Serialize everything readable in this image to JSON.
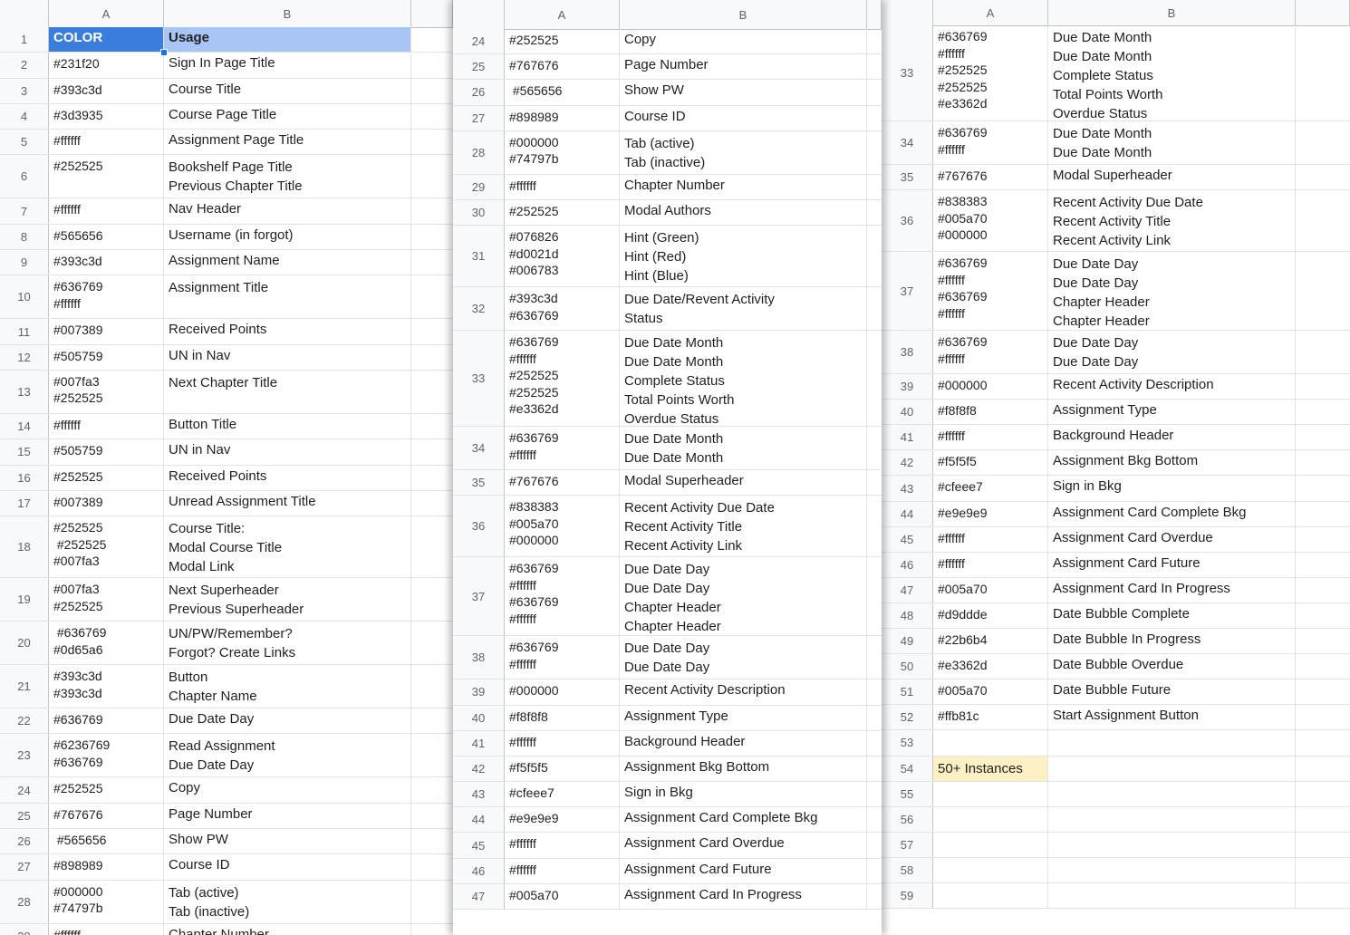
{
  "panels": [
    {
      "id": "p1",
      "column_headers": [
        "A",
        "B"
      ],
      "rows": [
        {
          "n": "1",
          "a": "COLOR",
          "b": "Usage"
        },
        {
          "n": "2",
          "a": "#231f20",
          "b": "Sign In Page Title"
        },
        {
          "n": "3",
          "a": "#393c3d",
          "b": "Course Title"
        },
        {
          "n": "4",
          "a": "#3d3935",
          "b": "Course Page Title"
        },
        {
          "n": "5",
          "a": "#ffffff",
          "b": "Assignment Page Title"
        },
        {
          "n": "6",
          "a": "#252525",
          "b": "Bookshelf Page Title\nPrevious Chapter Title"
        },
        {
          "n": "7",
          "a": "#ffffff",
          "b": "Nav Header"
        },
        {
          "n": "8",
          "a": "#565656",
          "b": "Username (in forgot)"
        },
        {
          "n": "9",
          "a": "#393c3d",
          "b": "Assignment Name"
        },
        {
          "n": "10",
          "a": "#636769\n#ffffff",
          "b": "Assignment Title"
        },
        {
          "n": "11",
          "a": "#007389",
          "b": "Received Points"
        },
        {
          "n": "12",
          "a": "#505759",
          "b": "UN in Nav"
        },
        {
          "n": "13",
          "a": "#007fa3\n#252525",
          "b": "Next Chapter Title"
        },
        {
          "n": "14",
          "a": "#ffffff",
          "b": "Button Title"
        },
        {
          "n": "15",
          "a": "#505759",
          "b": "UN in Nav"
        },
        {
          "n": "16",
          "a": "#252525",
          "b": "Received Points"
        },
        {
          "n": "17",
          "a": "#007389",
          "b": "Unread Assignment Title"
        },
        {
          "n": "18",
          "a": "#252525\n #252525\n#007fa3",
          "b": "Course Title:\nModal Course Title\nModal Link"
        },
        {
          "n": "19",
          "a": "#007fa3\n#252525",
          "b": "Next Superheader\nPrevious Superheader"
        },
        {
          "n": "20",
          "a": " #636769\n#0d65a6",
          "b": "UN/PW/Remember?\nForgot? Create Links"
        },
        {
          "n": "21",
          "a": "#393c3d\n#393c3d",
          "b": "Button\nChapter Name"
        },
        {
          "n": "22",
          "a": "#636769",
          "b": "Due Date Day"
        },
        {
          "n": "23",
          "a": "#6236769\n#636769",
          "b": "Read Assignment\nDue Date Day"
        },
        {
          "n": "24",
          "a": "#252525",
          "b": "Copy"
        },
        {
          "n": "25",
          "a": "#767676",
          "b": "Page Number"
        },
        {
          "n": "26",
          "a": " #565656",
          "b": "Show PW"
        },
        {
          "n": "27",
          "a": "#898989",
          "b": "Course ID"
        },
        {
          "n": "28",
          "a": "#000000\n#74797b",
          "b": "Tab (active)\nTab (inactive)"
        },
        {
          "n": "29",
          "a": "#ffffff",
          "b": "Chapter Number"
        }
      ]
    },
    {
      "id": "p2",
      "column_headers": [
        "A",
        "B"
      ],
      "rows": [
        {
          "n": "24",
          "a": "#252525",
          "b": "Copy"
        },
        {
          "n": "25",
          "a": "#767676",
          "b": "Page Number"
        },
        {
          "n": "26",
          "a": " #565656",
          "b": "Show PW"
        },
        {
          "n": "27",
          "a": "#898989",
          "b": "Course ID"
        },
        {
          "n": "28",
          "a": "#000000\n#74797b",
          "b": "Tab (active)\nTab (inactive)"
        },
        {
          "n": "29",
          "a": "#ffffff",
          "b": "Chapter Number"
        },
        {
          "n": "30",
          "a": "#252525",
          "b": "Modal Authors"
        },
        {
          "n": "31",
          "a": "#076826\n#d0021d\n#006783",
          "b": "Hint (Green)\nHint (Red)\nHint (Blue)"
        },
        {
          "n": "32",
          "a": "#393c3d\n#636769",
          "b": "Due Date/Revent Activity\nStatus"
        },
        {
          "n": "33",
          "a": "#636769\n#ffffff\n#252525\n#252525\n#e3362d",
          "b": "Due Date Month\nDue Date Month\nComplete Status\nTotal Points Worth\nOverdue Status"
        },
        {
          "n": "34",
          "a": "#636769\n#ffffff",
          "b": "Due Date Month\nDue Date Month"
        },
        {
          "n": "35",
          "a": "#767676",
          "b": "Modal Superheader"
        },
        {
          "n": "36",
          "a": "#838383\n#005a70\n#000000",
          "b": "Recent Activity Due Date\nRecent Activity Title\nRecent Activity Link"
        },
        {
          "n": "37",
          "a": "#636769\n#ffffff\n#636769\n#ffffff",
          "b": "Due Date Day\nDue Date Day\nChapter Header\nChapter Header"
        },
        {
          "n": "38",
          "a": "#636769\n#ffffff",
          "b": "Due Date Day\nDue Date Day"
        },
        {
          "n": "39",
          "a": "#000000",
          "b": "Recent Activity Description"
        },
        {
          "n": "40",
          "a": "#f8f8f8",
          "b": "Assignment Type"
        },
        {
          "n": "41",
          "a": "#ffffff",
          "b": "Background Header"
        },
        {
          "n": "42",
          "a": "#f5f5f5",
          "b": "Assignment Bkg Bottom"
        },
        {
          "n": "43",
          "a": "#cfeee7",
          "b": "Sign in Bkg"
        },
        {
          "n": "44",
          "a": "#e9e9e9",
          "b": "Assignment Card Complete Bkg"
        },
        {
          "n": "45",
          "a": "#ffffff",
          "b": "Assignment Card Overdue"
        },
        {
          "n": "46",
          "a": "#ffffff",
          "b": "Assignment Card Future"
        },
        {
          "n": "47",
          "a": "#005a70",
          "b": "Assignment Card In Progress"
        }
      ]
    },
    {
      "id": "p3",
      "column_headers": [
        "A",
        "B"
      ],
      "rows": [
        {
          "n": "33",
          "a": "#636769\n#ffffff\n#252525\n#252525\n#e3362d",
          "b": "Due Date Month\nDue Date Month\nComplete Status\nTotal Points Worth\nOverdue Status"
        },
        {
          "n": "34",
          "a": "#636769\n#ffffff",
          "b": "Due Date Month\nDue Date Month"
        },
        {
          "n": "35",
          "a": "#767676",
          "b": "Modal Superheader"
        },
        {
          "n": "36",
          "a": "#838383\n#005a70\n#000000",
          "b": "Recent Activity Due Date\nRecent Activity Title\nRecent Activity Link"
        },
        {
          "n": "37",
          "a": "#636769\n#ffffff\n#636769\n#ffffff",
          "b": "Due Date Day\nDue Date Day\nChapter Header\nChapter Header"
        },
        {
          "n": "38",
          "a": "#636769\n#ffffff",
          "b": "Due Date Day\nDue Date Day"
        },
        {
          "n": "39",
          "a": "#000000",
          "b": "Recent Activity Description"
        },
        {
          "n": "40",
          "a": "#f8f8f8",
          "b": "Assignment Type"
        },
        {
          "n": "41",
          "a": "#ffffff",
          "b": "Background Header"
        },
        {
          "n": "42",
          "a": "#f5f5f5",
          "b": "Assignment Bkg Bottom"
        },
        {
          "n": "43",
          "a": "#cfeee7",
          "b": "Sign in Bkg"
        },
        {
          "n": "44",
          "a": "#e9e9e9",
          "b": "Assignment Card Complete Bkg"
        },
        {
          "n": "45",
          "a": "#ffffff",
          "b": "Assignment Card Overdue"
        },
        {
          "n": "46",
          "a": "#ffffff",
          "b": "Assignment Card Future"
        },
        {
          "n": "47",
          "a": "#005a70",
          "b": "Assignment Card In Progress"
        },
        {
          "n": "48",
          "a": "#d9ddde",
          "b": "Date Bubble Complete"
        },
        {
          "n": "49",
          "a": "#22b6b4",
          "b": "Date Bubble In Progress"
        },
        {
          "n": "50",
          "a": "#e3362d",
          "b": "Date Bubble Overdue"
        },
        {
          "n": "51",
          "a": "#005a70",
          "b": "Date Bubble Future"
        },
        {
          "n": "52",
          "a": "#ffb81c",
          "b": "Start Assignment Button"
        },
        {
          "n": "53",
          "a": "",
          "b": ""
        },
        {
          "n": "54",
          "a": "50+ Instances",
          "b": ""
        },
        {
          "n": "55",
          "a": "",
          "b": ""
        },
        {
          "n": "56",
          "a": "",
          "b": ""
        },
        {
          "n": "57",
          "a": "",
          "b": ""
        },
        {
          "n": "58",
          "a": "",
          "b": ""
        },
        {
          "n": "59",
          "a": "",
          "b": ""
        }
      ]
    }
  ],
  "colors": {
    "selected_cell": "#3b7ddd",
    "selected_range": "#a8c5f6",
    "highlight_yellow": "#fdf0c4",
    "header_bg": "#f8f9fa"
  }
}
